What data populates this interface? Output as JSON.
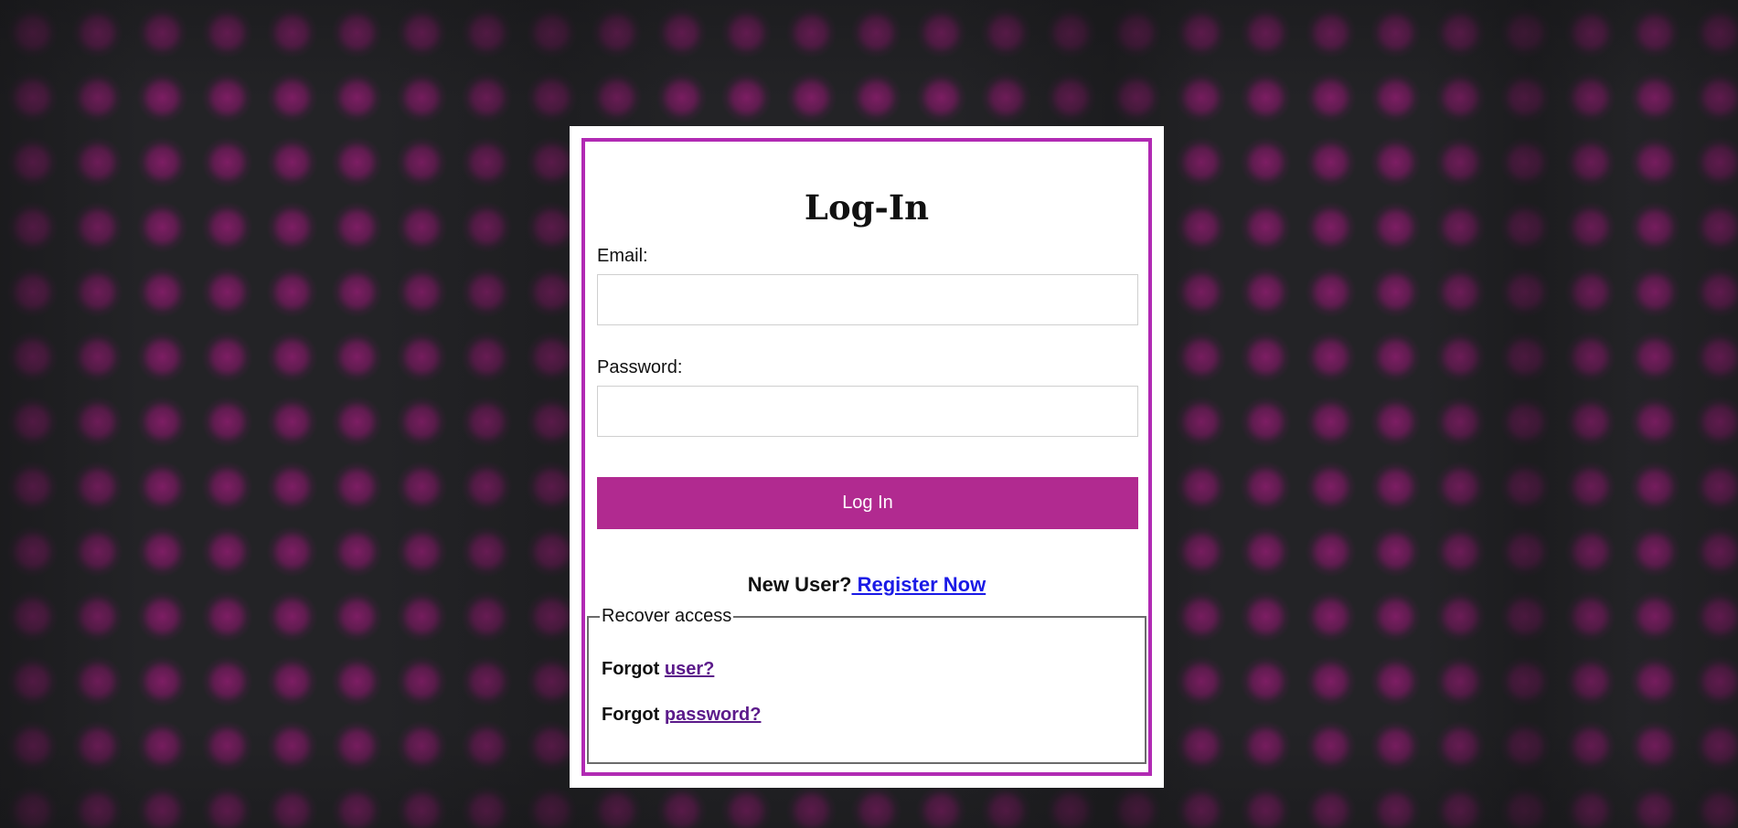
{
  "page": {
    "accent_color": "#b12ab3",
    "button_color": "#b12a90",
    "background_pattern": "magenta-dots-on-dark"
  },
  "login": {
    "title": "Log-In",
    "email_label": "Email:",
    "email_value": "",
    "password_label": "Password:",
    "password_value": "",
    "submit_label": "Log In"
  },
  "register": {
    "prompt": "New User?",
    "link_label": " Register Now"
  },
  "recover": {
    "legend": "Recover access",
    "forgot_prefix": "Forgot ",
    "user_link": "user?",
    "password_link": "password?"
  }
}
